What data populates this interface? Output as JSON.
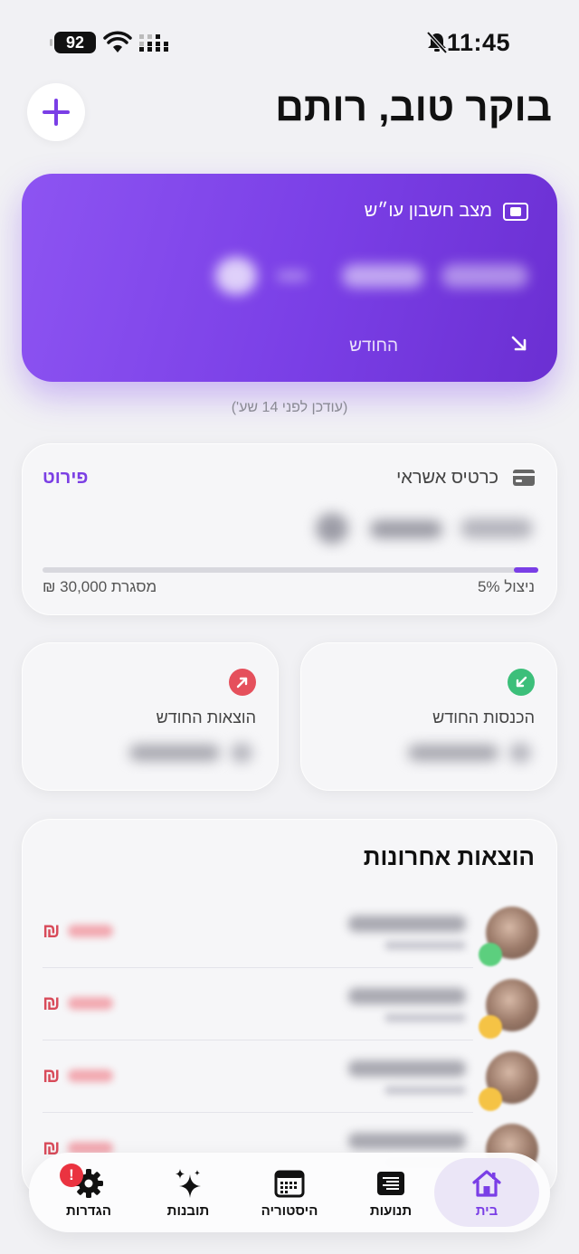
{
  "status_bar": {
    "time": "11:45",
    "battery": "92"
  },
  "header": {
    "greeting": "בוקר טוב, רותם"
  },
  "balance": {
    "title": "מצב חשבון עו״ש",
    "period": "החודש",
    "updated": "(עודכן לפני 14 שע')"
  },
  "credit_card": {
    "title": "כרטיס אשראי",
    "details_link": "פירוט",
    "limit": "מסגרת 30,000 ₪",
    "usage": "ניצול 5%",
    "usage_fraction": 0.05
  },
  "stats": {
    "income_label": "הכנסות החודש",
    "expense_label": "הוצאות החודש",
    "income_color": "#3cbf7a",
    "expense_color": "#e5505c"
  },
  "recent": {
    "title": "הוצאות אחרונות",
    "currency_symbol": "₪",
    "rows": [
      {
        "badge_color": "#5ccf7e"
      },
      {
        "badge_color": "#f5c345"
      },
      {
        "badge_color": "#f5c345"
      },
      {
        "badge_color": "#f5c345"
      }
    ]
  },
  "tabs": [
    {
      "key": "home",
      "label": "בית",
      "icon": "home-icon",
      "active": true
    },
    {
      "key": "transactions",
      "label": "תנועות",
      "icon": "list-icon",
      "active": false
    },
    {
      "key": "history",
      "label": "היסטוריה",
      "icon": "calendar-icon",
      "active": false
    },
    {
      "key": "insights",
      "label": "תובנות",
      "icon": "sparkle-icon",
      "active": false
    },
    {
      "key": "settings",
      "label": "הגדרות",
      "icon": "gear-icon",
      "active": false,
      "badge": "!"
    }
  ],
  "colors": {
    "accent": "#7a3ee6",
    "negative": "#d84b5a"
  }
}
